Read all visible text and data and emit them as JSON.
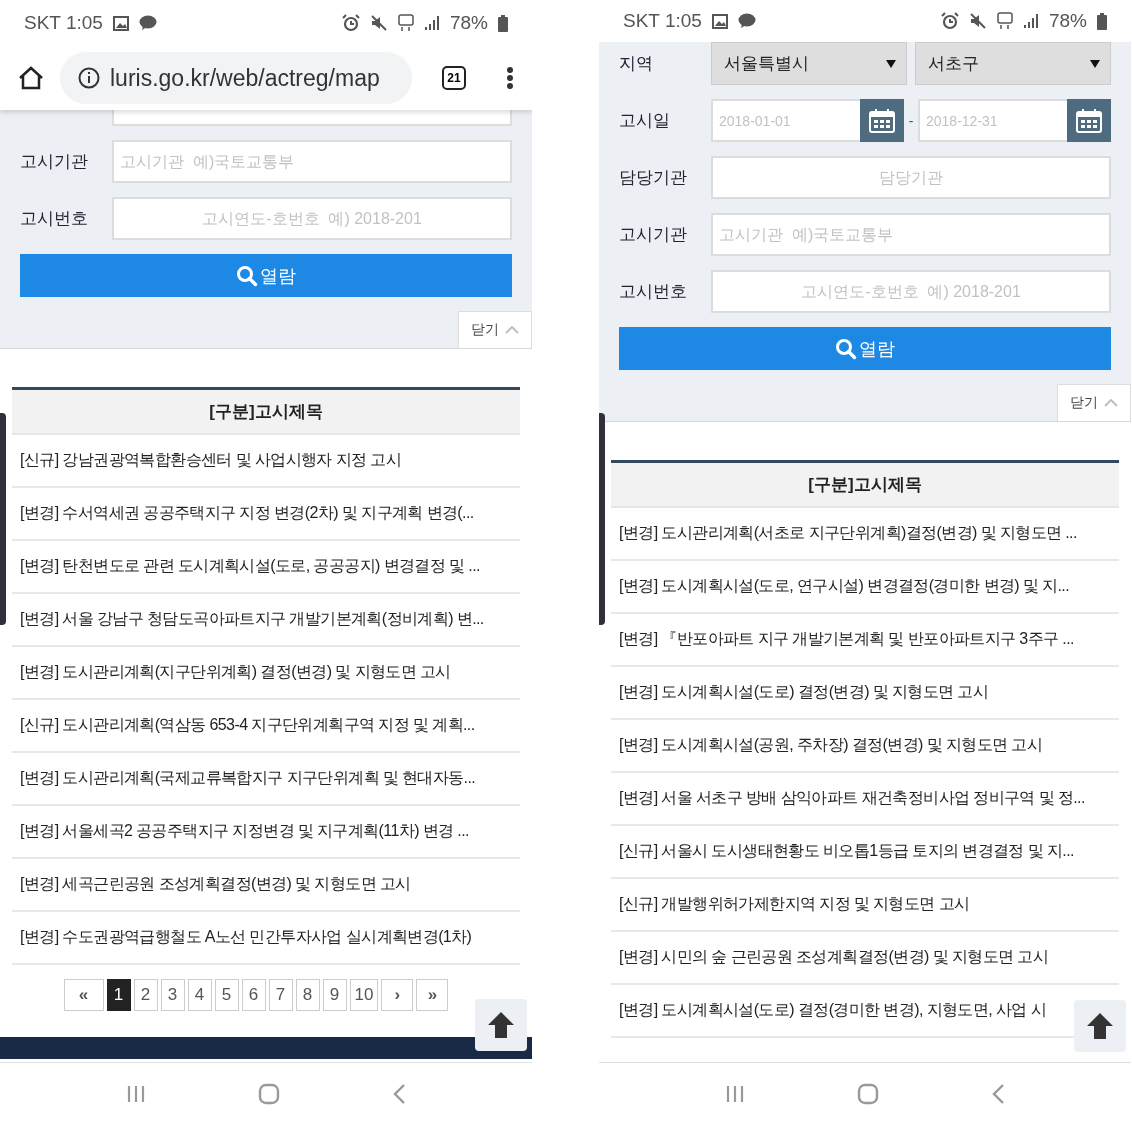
{
  "screens": [
    {
      "status_bar": {
        "carrier_time": "SKT 1:05",
        "battery": "78%"
      },
      "browser": {
        "url": "luris.go.kr/web/actreg/map",
        "tab_count": "21"
      },
      "form": {
        "top_cut": true,
        "fields": [
          {
            "kind": "text",
            "label": "고시기관",
            "placeholder": "고시기관  예)국토교통부"
          },
          {
            "kind": "centered-text",
            "label": "고시번호",
            "placeholder": "고시연도-호번호  예) 2018-201"
          }
        ],
        "search_button": "열람",
        "close_button": "닫기"
      },
      "list": {
        "header": "[구분]고시제목",
        "rows": [
          "[신규] 강남권광역복합환승센터 및 사업시행자 지정 고시",
          "[변경] 수서역세권 공공주택지구 지정 변경(2차) 및 지구계획 변경(...",
          "[변경] 탄천변도로 관련 도시계획시설(도로, 공공공지) 변경결정 및 ...",
          "[변경] 서울 강남구 청담도곡아파트지구 개발기본계획(정비계획) 변...",
          "[변경] 도시관리계획(지구단위계획) 결정(변경) 및 지형도면 고시",
          "[신규] 도시관리계획(역삼동 653-4 지구단위계획구역 지정 및 계획...",
          "[변경] 도시관리계획(국제교류복합지구 지구단위계획 및 현대자동...",
          "[변경] 서울세곡2 공공주택지구 지정변경 및 지구계획(11차) 변경 ...",
          "[변경] 세곡근린공원 조성계획결정(변경) 및 지형도면 고시",
          "[변경] 수도권광역급행철도 A노선 민간투자사업 실시계획변경(1차)"
        ]
      },
      "pagination": {
        "first": "«",
        "next": "›",
        "last": "»",
        "pages": [
          {
            "label": "1",
            "selected": true
          },
          {
            "label": "2",
            "selected": false
          },
          {
            "label": "3",
            "selected": false
          },
          {
            "label": "4",
            "selected": false
          },
          {
            "label": "5",
            "selected": false
          },
          {
            "label": "6",
            "selected": false
          },
          {
            "label": "7",
            "selected": false
          },
          {
            "label": "8",
            "selected": false
          },
          {
            "label": "9",
            "selected": false
          },
          {
            "label": "10",
            "selected": false
          }
        ]
      },
      "footer_bar": true
    },
    {
      "status_bar": {
        "carrier_time": "SKT 1:05",
        "battery": "78%"
      },
      "form": {
        "fields": [
          {
            "kind": "region",
            "label": "지역",
            "selects": [
              "서울특별시",
              "서초구"
            ]
          },
          {
            "kind": "date-range",
            "label": "고시일",
            "from_placeholder": "2018-01-01",
            "separator": "-",
            "to_placeholder": "2018-12-31"
          },
          {
            "kind": "centered-text",
            "label": "담당기관",
            "placeholder": "담당기관"
          },
          {
            "kind": "text",
            "label": "고시기관",
            "placeholder": "고시기관  예)국토교통부"
          },
          {
            "kind": "centered-text",
            "label": "고시번호",
            "placeholder": "고시연도-호번호  예) 2018-201"
          }
        ],
        "search_button": "열람",
        "close_button": "닫기"
      },
      "list": {
        "header": "[구분]고시제목",
        "rows": [
          "[변경] 도시관리계획(서초로 지구단위계획)결정(변경) 및 지형도면 ...",
          "[변경] 도시계획시설(도로, 연구시설) 변경결정(경미한 변경) 및 지...",
          "[변경] 『반포아파트 지구 개발기본계획 및 반포아파트지구 3주구 ...",
          "[변경] 도시계획시설(도로) 결정(변경) 및 지형도면 고시",
          "[변경] 도시계획시설(공원, 주차장) 결정(변경) 및 지형도면 고시",
          "[변경] 서울 서초구 방배 삼익아파트 재건축정비사업 정비구역 및 정...",
          "[신규] 서울시 도시생태현황도 비오톱1등급 토지의 변경결정 및 지...",
          "[신규] 개발행위허가제한지역 지정 및 지형도면 고시",
          "[변경] 시민의 숲 근린공원 조성계획결정(변경) 및 지형도면 고시",
          "[변경] 도시계획시설(도로) 결정(경미한 변경), 지형도면, 사업 시"
        ]
      }
    }
  ]
}
